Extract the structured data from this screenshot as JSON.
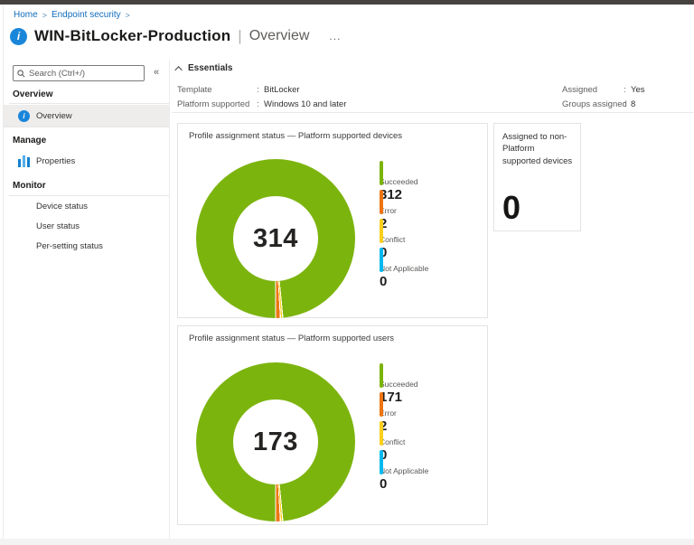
{
  "breadcrumb": {
    "home": "Home",
    "sep1": ">",
    "section": "Endpoint security",
    "sep2": ">"
  },
  "header": {
    "info_glyph": "i",
    "title": "WIN-BitLocker-Production",
    "pipe": "|",
    "subtitle": "Overview",
    "more": "..."
  },
  "sidebar": {
    "search_placeholder": "Search (Ctrl+/)",
    "collapse_glyph": "«",
    "overview_header": "Overview",
    "overview_item": "Overview",
    "overview_item_icon_glyph": "i",
    "manage_header": "Manage",
    "properties_item": "Properties",
    "monitor_header": "Monitor",
    "monitor_items": [
      "Device status",
      "User status",
      "Per-setting status"
    ]
  },
  "essentials": {
    "title": "Essentials",
    "left": [
      {
        "label": "Template",
        "colon": ":",
        "value": "BitLocker"
      },
      {
        "label": "Platform supported",
        "colon": ":",
        "value": "Windows 10 and later"
      }
    ],
    "right": [
      {
        "label": "Assigned",
        "colon": ":",
        "value": "Yes"
      },
      {
        "label": "Groups assigned",
        "colon": ":",
        "value": "8"
      }
    ]
  },
  "cards": {
    "devices": {
      "title": "Profile assignment status — Platform supported devices",
      "total": "314",
      "legend": [
        {
          "label": "Succeeded",
          "value": "312",
          "color": "#7cb40e"
        },
        {
          "label": "Error",
          "value": "2",
          "color": "#ee7511"
        },
        {
          "label": "Conflict",
          "value": "0",
          "color": "#fbcf1c"
        },
        {
          "label": "Not Applicable",
          "value": "0",
          "color": "#00b9f0"
        }
      ]
    },
    "users": {
      "title": "Profile assignment status — Platform supported users",
      "total": "173",
      "legend": [
        {
          "label": "Succeeded",
          "value": "171",
          "color": "#7cb40e"
        },
        {
          "label": "Error",
          "value": "2",
          "color": "#ee7511"
        },
        {
          "label": "Conflict",
          "value": "0",
          "color": "#fbcf1c"
        },
        {
          "label": "Not Applicable",
          "value": "0",
          "color": "#00b9f0"
        }
      ]
    },
    "non_platform": {
      "title": "Assigned to non-Platform supported devices",
      "value": "0"
    }
  },
  "chart_data": [
    {
      "type": "pie",
      "title": "Profile assignment status — Platform supported devices",
      "categories": [
        "Succeeded",
        "Error",
        "Conflict",
        "Not Applicable"
      ],
      "values": [
        312,
        2,
        0,
        0
      ],
      "total_label": 314,
      "colors": [
        "#7cb40e",
        "#ee7511",
        "#fbcf1c",
        "#00b9f0"
      ],
      "legend_position": "right",
      "donut": true
    },
    {
      "type": "pie",
      "title": "Profile assignment status — Platform supported users",
      "categories": [
        "Succeeded",
        "Error",
        "Conflict",
        "Not Applicable"
      ],
      "values": [
        171,
        2,
        0,
        0
      ],
      "total_label": 173,
      "colors": [
        "#7cb40e",
        "#ee7511",
        "#fbcf1c",
        "#00b9f0"
      ],
      "legend_position": "right",
      "donut": true
    }
  ]
}
